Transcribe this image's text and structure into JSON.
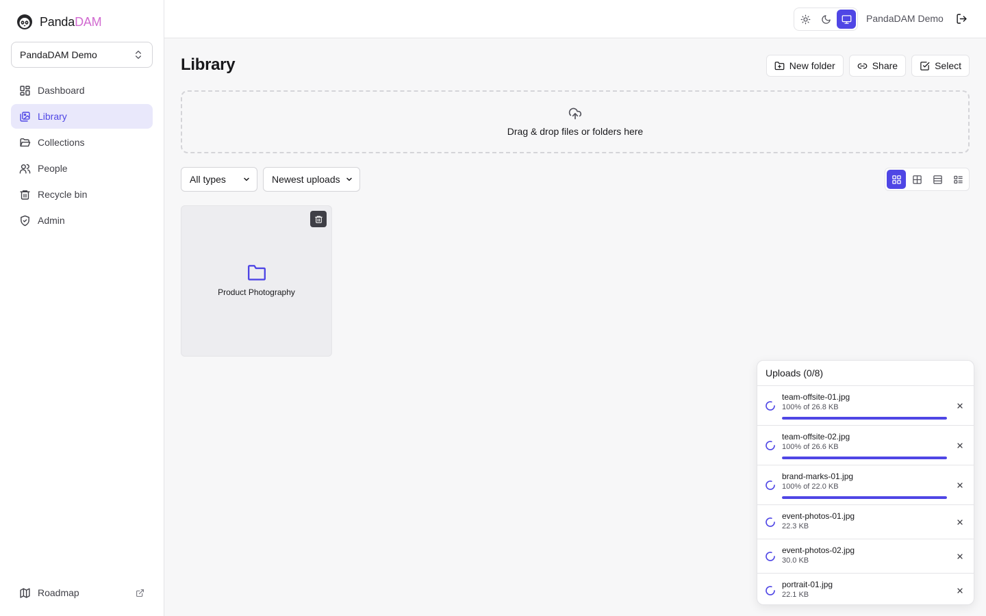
{
  "brand": {
    "name_part1": "Panda",
    "name_part2": "DAM",
    "accent": "#d16ad0"
  },
  "workspace": {
    "selected": "PandaDAM Demo"
  },
  "sidebar": {
    "items": [
      {
        "label": "Dashboard",
        "icon": "grid-icon"
      },
      {
        "label": "Library",
        "icon": "images-icon",
        "active": true
      },
      {
        "label": "Collections",
        "icon": "folder-open-icon"
      },
      {
        "label": "People",
        "icon": "users-icon"
      },
      {
        "label": "Recycle bin",
        "icon": "trash-icon"
      },
      {
        "label": "Admin",
        "icon": "shield-check-icon"
      }
    ],
    "footer": {
      "label": "Roadmap",
      "icon": "map-icon"
    }
  },
  "topbar": {
    "theme_modes": [
      "light",
      "dark",
      "system"
    ],
    "theme_selected": "system",
    "user_name": "PandaDAM Demo"
  },
  "main": {
    "title": "Library",
    "actions": {
      "new_folder": "New folder",
      "share": "Share",
      "select": "Select"
    },
    "dropzone_text": "Drag & drop files or folders here",
    "filters": {
      "type": "All types",
      "sort": "Newest uploads"
    },
    "view_modes": [
      "grid-large",
      "grid-small",
      "list",
      "details"
    ],
    "view_selected": "grid-large",
    "folders": [
      {
        "name": "Product Photography"
      }
    ]
  },
  "uploads": {
    "title": "Uploads (0/8)",
    "items": [
      {
        "name": "team-offsite-01.jpg",
        "meta": "100% of 26.8 KB",
        "progress": 1.0
      },
      {
        "name": "team-offsite-02.jpg",
        "meta": "100% of 26.6 KB",
        "progress": 1.0
      },
      {
        "name": "brand-marks-01.jpg",
        "meta": "100% of 22.0 KB",
        "progress": 1.0
      },
      {
        "name": "event-photos-01.jpg",
        "meta": "22.3 KB",
        "progress": null
      },
      {
        "name": "event-photos-02.jpg",
        "meta": "30.0 KB",
        "progress": null
      },
      {
        "name": "portrait-01.jpg",
        "meta": "22.1 KB",
        "progress": null
      }
    ]
  },
  "colors": {
    "primary": "#4f46e5",
    "active_nav_bg": "#e9e8fb"
  }
}
